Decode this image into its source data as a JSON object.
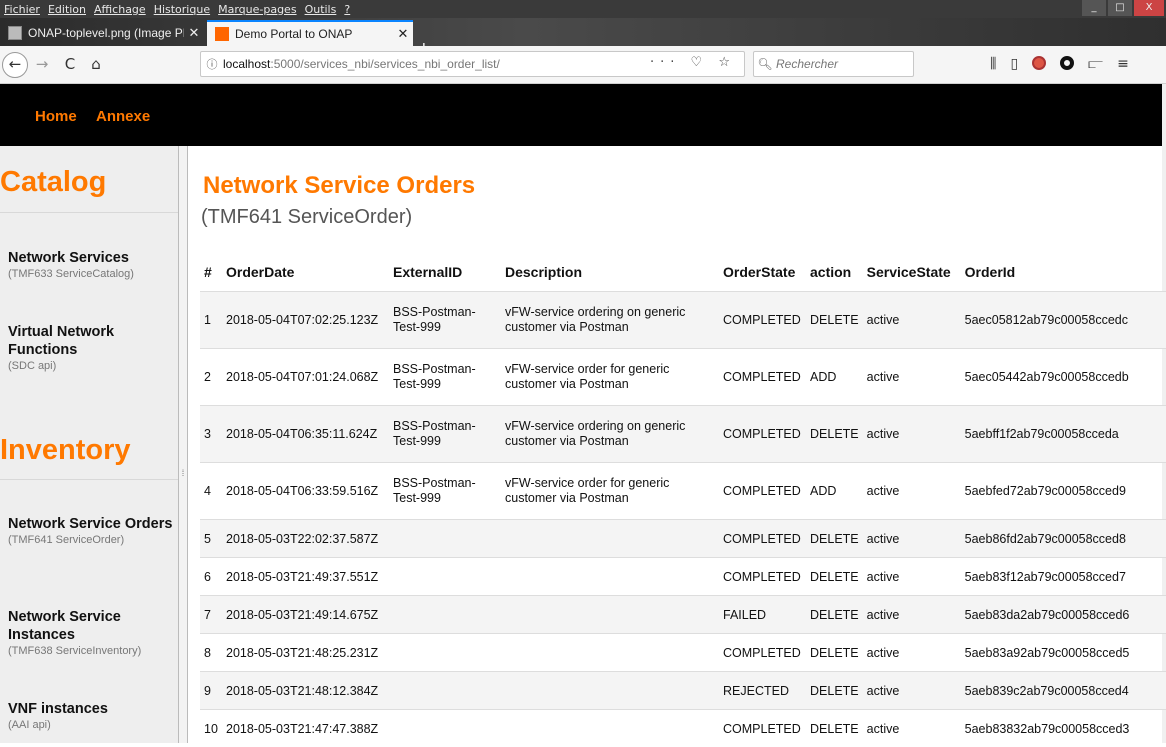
{
  "menu": [
    "Fichier",
    "Edition",
    "Affichage",
    "Historique",
    "Marque-pages",
    "Outils",
    "?"
  ],
  "window_controls": [
    "_",
    "□",
    "X"
  ],
  "tabs": [
    {
      "label": "ONAP-toplevel.png (Image PN",
      "close": "✕"
    },
    {
      "label": "Demo Portal to ONAP",
      "close": "✕"
    }
  ],
  "new_tab": "+",
  "nav": {
    "back": "←",
    "forward": "→",
    "reload": "C",
    "home": "⌂"
  },
  "url": {
    "info_icon": "ⓘ",
    "host": "localhost",
    "path": ":5000/services_nbi/services_nbi_order_list/",
    "actions": "··· ♡ ☆"
  },
  "search": {
    "icon": "🔍︎",
    "placeholder": "Rechercher"
  },
  "toolbar_icons": {
    "library": "⫼",
    "sidebar": "▯",
    "reader": "⫍",
    "menu": "≡"
  },
  "header_nav": {
    "home": "Home",
    "annexe": "Annexe"
  },
  "sidebar": {
    "catalog_heading": "Catalog",
    "inventory_heading": "Inventory",
    "grip": "⁞",
    "items": [
      {
        "title": "Network Services",
        "sub": "(TMF633 ServiceCatalog)"
      },
      {
        "title": "Virtual Network Functions",
        "sub": "(SDC api)"
      },
      {
        "title": "Network Service Orders",
        "sub": "(TMF641 ServiceOrder)"
      },
      {
        "title": "Network Service Instances",
        "sub": "(TMF638 ServiceInventory)"
      },
      {
        "title": "VNF instances",
        "sub": "(AAI api)"
      }
    ]
  },
  "page": {
    "title": "Network Service Orders",
    "subtitle": "(TMF641 ServiceOrder)"
  },
  "table": {
    "headers": [
      "#",
      "OrderDate",
      "ExternalID",
      "Description",
      "OrderState",
      "action",
      "ServiceState",
      "OrderId"
    ],
    "rows": [
      {
        "n": "1",
        "date": "2018-05-04T07:02:25.123Z",
        "ext": "BSS-Postman-Test-999",
        "desc": "vFW-service ordering on generic customer via Postman",
        "state": "COMPLETED",
        "action": "DELETE",
        "svc": "active",
        "id": "5aec05812ab79c00058ccedc"
      },
      {
        "n": "2",
        "date": "2018-05-04T07:01:24.068Z",
        "ext": "BSS-Postman-Test-999",
        "desc": "vFW-service order for generic customer via Postman",
        "state": "COMPLETED",
        "action": "ADD",
        "svc": "active",
        "id": "5aec05442ab79c00058ccedb"
      },
      {
        "n": "3",
        "date": "2018-05-04T06:35:11.624Z",
        "ext": "BSS-Postman-Test-999",
        "desc": "vFW-service ordering on generic customer via Postman",
        "state": "COMPLETED",
        "action": "DELETE",
        "svc": "active",
        "id": "5aebff1f2ab79c00058cceda"
      },
      {
        "n": "4",
        "date": "2018-05-04T06:33:59.516Z",
        "ext": "BSS-Postman-Test-999",
        "desc": "vFW-service order for generic customer via Postman",
        "state": "COMPLETED",
        "action": "ADD",
        "svc": "active",
        "id": "5aebfed72ab79c00058cced9"
      },
      {
        "n": "5",
        "date": "2018-05-03T22:02:37.587Z",
        "ext": "",
        "desc": "",
        "state": "COMPLETED",
        "action": "DELETE",
        "svc": "active",
        "id": "5aeb86fd2ab79c00058cced8"
      },
      {
        "n": "6",
        "date": "2018-05-03T21:49:37.551Z",
        "ext": "",
        "desc": "",
        "state": "COMPLETED",
        "action": "DELETE",
        "svc": "active",
        "id": "5aeb83f12ab79c00058cced7"
      },
      {
        "n": "7",
        "date": "2018-05-03T21:49:14.675Z",
        "ext": "",
        "desc": "",
        "state": "FAILED",
        "action": "DELETE",
        "svc": "active",
        "id": "5aeb83da2ab79c00058cced6"
      },
      {
        "n": "8",
        "date": "2018-05-03T21:48:25.231Z",
        "ext": "",
        "desc": "",
        "state": "COMPLETED",
        "action": "DELETE",
        "svc": "active",
        "id": "5aeb83a92ab79c00058cced5"
      },
      {
        "n": "9",
        "date": "2018-05-03T21:48:12.384Z",
        "ext": "",
        "desc": "",
        "state": "REJECTED",
        "action": "DELETE",
        "svc": "active",
        "id": "5aeb839c2ab79c00058cced4"
      },
      {
        "n": "10",
        "date": "2018-05-03T21:47:47.388Z",
        "ext": "",
        "desc": "",
        "state": "COMPLETED",
        "action": "DELETE",
        "svc": "active",
        "id": "5aeb83832ab79c00058cced3"
      }
    ]
  },
  "colors": {
    "accent": "#ff7900",
    "header_bg": "#000000",
    "sidebar_bg": "#eeeeee"
  }
}
